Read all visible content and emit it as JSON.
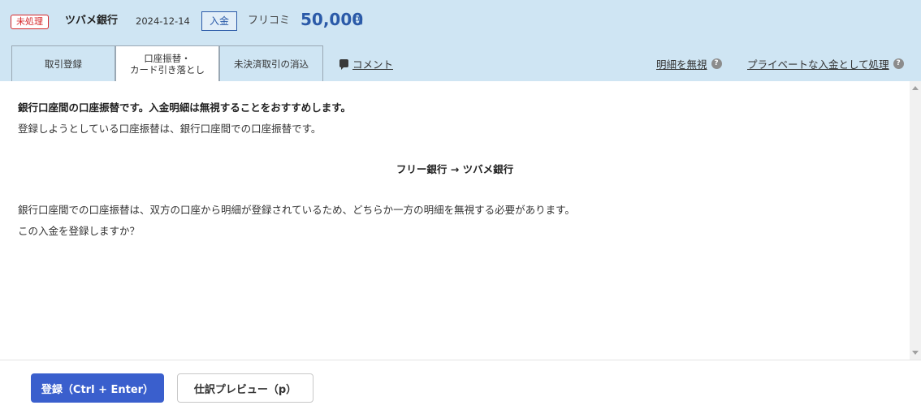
{
  "header": {
    "status": "未処理",
    "bank": "ツバメ銀行",
    "date": "2024-12-14",
    "type": "入金",
    "description": "フリコミ",
    "amount": "50,000",
    "currency": "円"
  },
  "tabs": [
    {
      "label": "取引登録",
      "active": false
    },
    {
      "label_line1": "口座振替・",
      "label_line2": "カード引き落とし",
      "active": true
    },
    {
      "label": "未決済取引の消込",
      "active": false
    }
  ],
  "links": {
    "comment": "コメント",
    "ignore": "明細を無視",
    "private": "プライベートな入金として処理"
  },
  "content": {
    "strong_message": "銀行口座間の口座振替です。入金明細は無視することをおすすめします。",
    "message1": "登録しようとしている口座振替は、銀行口座間での口座振替です。",
    "transfer": "フリー銀行 → ツバメ銀行",
    "message2": "銀行口座間での口座振替は、双方の口座から明細が登録されているため、どちらか一方の明細を無視する必要があります。",
    "message3": "この入金を登録しますか？"
  },
  "footer": {
    "register_label": "登録（Ctrl + Enter）",
    "preview_label": "仕訳プレビュー（p）"
  },
  "colors": {
    "header_bg": "#cfe5f3",
    "accent_blue": "#2b5aa8",
    "button_blue": "#3a5fcd",
    "status_red": "#d6272a"
  }
}
